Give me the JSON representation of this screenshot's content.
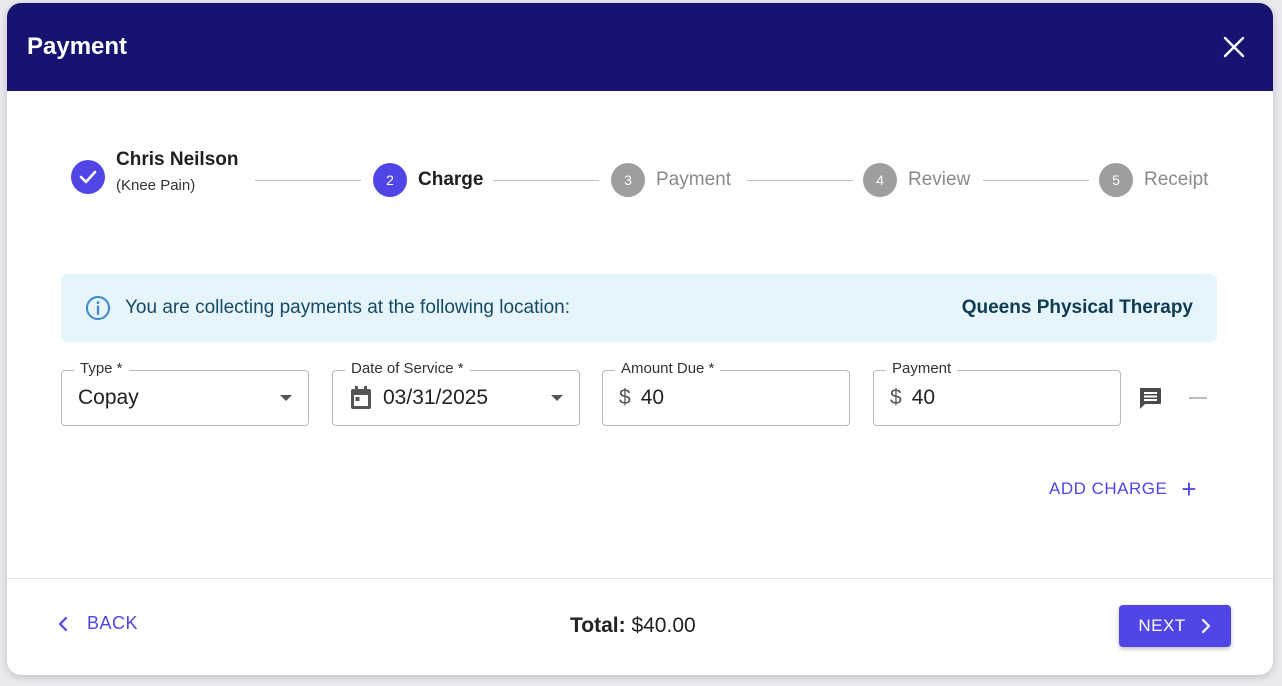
{
  "header": {
    "title": "Payment"
  },
  "stepper": {
    "step1": {
      "name": "Chris Neilson",
      "sub": "(Knee Pain)"
    },
    "step2": {
      "number": "2",
      "label": "Charge"
    },
    "step3": {
      "number": "3",
      "label": "Payment"
    },
    "step4": {
      "number": "4",
      "label": "Review"
    },
    "step5": {
      "number": "5",
      "label": "Receipt"
    }
  },
  "info": {
    "text": "You are collecting payments at the following location:",
    "location": "Queens Physical Therapy"
  },
  "charge": {
    "type": {
      "label": "Type *",
      "value": "Copay"
    },
    "date": {
      "label": "Date of Service *",
      "value": "03/31/2025"
    },
    "amount_due": {
      "label": "Amount Due *",
      "prefix": "$",
      "value": "40"
    },
    "payment": {
      "label": "Payment",
      "prefix": "$",
      "value": "40"
    }
  },
  "actions": {
    "add_charge": "ADD CHARGE",
    "add_charge_icon": "+",
    "back": "BACK",
    "next": "NEXT"
  },
  "footer": {
    "total_label": "Total:",
    "total_value": "$40.00"
  },
  "colors": {
    "header": "#161470",
    "accent": "#4f46e5",
    "info_bg": "#e6f4fc"
  }
}
